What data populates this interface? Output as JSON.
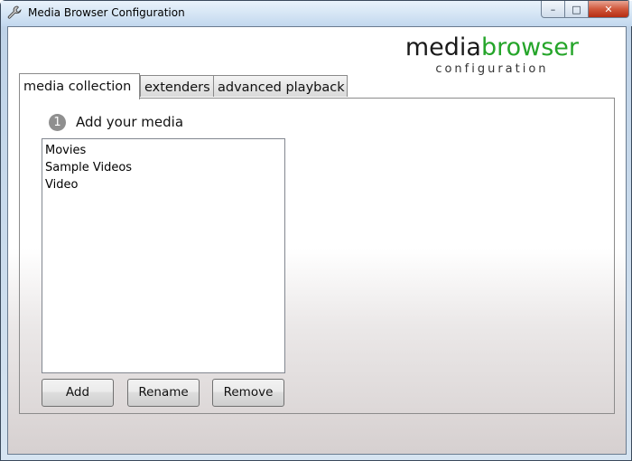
{
  "window": {
    "title": "Media Browser Configuration",
    "controls": {
      "minimize": "–",
      "maximize": "□",
      "close": "✕"
    }
  },
  "logo": {
    "main_dark": "media",
    "main_green": "browser",
    "sub": "configuration"
  },
  "tabs": [
    {
      "label": "media collection",
      "active": true
    },
    {
      "label": "extenders",
      "active": false
    },
    {
      "label": "advanced playback",
      "active": false
    }
  ],
  "section": {
    "step_number": "1",
    "heading": "Add your media"
  },
  "media_list": [
    "Movies",
    "Sample Videos",
    "Video"
  ],
  "buttons": {
    "add": "Add",
    "rename": "Rename",
    "remove": "Remove"
  },
  "colors": {
    "brand_green": "#25a52a",
    "close_red": "#c63a1e"
  }
}
